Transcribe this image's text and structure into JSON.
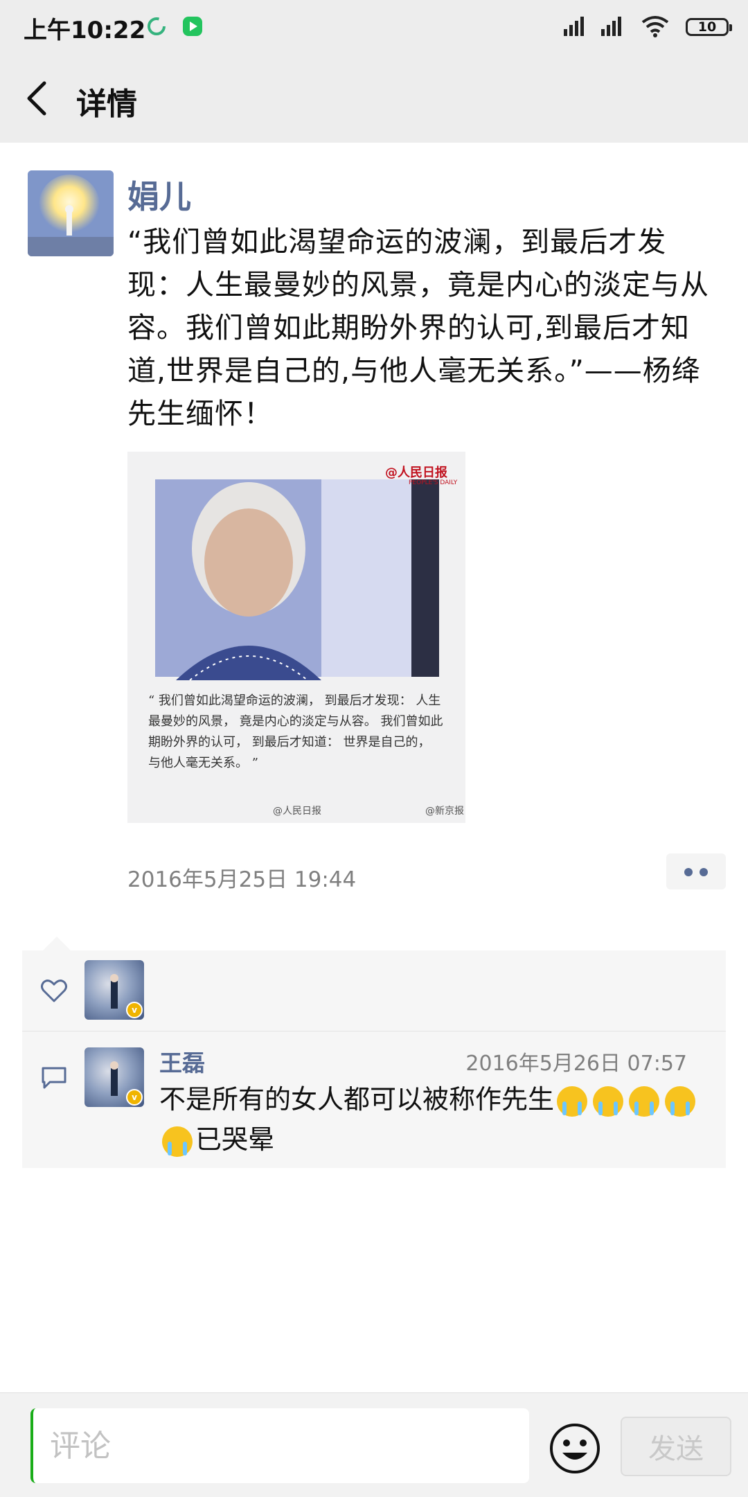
{
  "status_bar": {
    "time": "上午10:22",
    "battery": "10"
  },
  "header": {
    "title": "详情"
  },
  "post": {
    "author": "娟儿",
    "text": "“我们曾如此渴望命运的波澜，到最后才发现：人生最曼妙的风景，竟是内心的淡定与从容。我们曾如此期盼外界的认可,到最后才知道,世界是自己的,与他人毫无关系。”——杨绛 先生缅怀！",
    "image": {
      "brand": "@人民日报",
      "brand_sub": "PEOPLE'S DAILY",
      "quote": "“ 我们曾如此渴望命运的波澜， 到最后才发现： 人生最曼妙的风景， 竟是内心的淡定与从容。 我们曾如此期盼外界的认可， 到最后才知道： 世界是自己的， 与他人毫无关系。 ”",
      "credit_left": "@人民日报",
      "credit_right": "@新京报"
    },
    "time": "2016年5月25日 19:44"
  },
  "interactions": {
    "comment": {
      "name": "王磊",
      "time": "2016年5月26日 07:57",
      "text_part1": "不是所有的女人都可以被称作先生",
      "text_part2": "已哭晕"
    }
  },
  "bottom_bar": {
    "placeholder": "评论",
    "send_label": "发送"
  },
  "colors": {
    "link_blue": "#576b95",
    "accent_green": "#1aad19",
    "header_bg": "#ededed"
  }
}
